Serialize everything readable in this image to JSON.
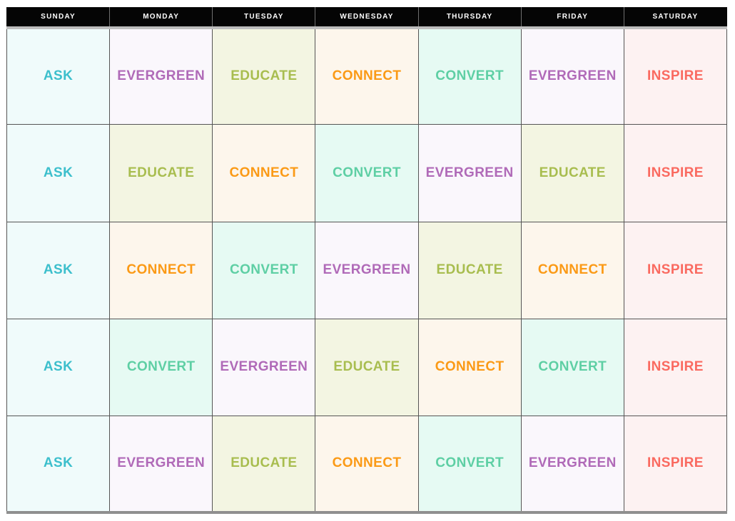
{
  "header": {
    "days": [
      "SUNDAY",
      "MONDAY",
      "TUESDAY",
      "WEDNESDAY",
      "THURSDAY",
      "FRIDAY",
      "SATURDAY"
    ]
  },
  "legend": {
    "categories": [
      {
        "key": "ASK",
        "label": "ASK",
        "text_color": "#3cbfcc",
        "cell_color": "#f0fbfb"
      },
      {
        "key": "EVERGREEN",
        "label": "EVERGREEN",
        "text_color": "#b06ab8",
        "cell_color": "#faf7fc"
      },
      {
        "key": "EDUCATE",
        "label": "EDUCATE",
        "text_color": "#a8bd4f",
        "cell_color": "#f3f5e2"
      },
      {
        "key": "CONNECT",
        "label": "CONNECT",
        "text_color": "#fb9a16",
        "cell_color": "#fdf6ec"
      },
      {
        "key": "CONVERT",
        "label": "CONVERT",
        "text_color": "#5ecfa4",
        "cell_color": "#e6faf3"
      },
      {
        "key": "INSPIRE",
        "label": "INSPIRE",
        "text_color": "#fa6a60",
        "cell_color": "#fdf2f2"
      }
    ]
  },
  "grid": {
    "rows": [
      {
        "row_index": 1,
        "cells": [
          {
            "day": "SUNDAY",
            "label": "ASK",
            "text_color": "#3cbfcc",
            "cell_color": "#f0fbfb"
          },
          {
            "day": "MONDAY",
            "label": "EVERGREEN",
            "text_color": "#b06ab8",
            "cell_color": "#faf7fc"
          },
          {
            "day": "TUESDAY",
            "label": "EDUCATE",
            "text_color": "#a8bd4f",
            "cell_color": "#f3f5e2"
          },
          {
            "day": "WEDNESDAY",
            "label": "CONNECT",
            "text_color": "#fb9a16",
            "cell_color": "#fdf6ec"
          },
          {
            "day": "THURSDAY",
            "label": "CONVERT",
            "text_color": "#5ecfa4",
            "cell_color": "#e6faf3"
          },
          {
            "day": "FRIDAY",
            "label": "EVERGREEN",
            "text_color": "#b06ab8",
            "cell_color": "#faf7fc"
          },
          {
            "day": "SATURDAY",
            "label": "INSPIRE",
            "text_color": "#fa6a60",
            "cell_color": "#fdf2f2"
          }
        ]
      },
      {
        "row_index": 2,
        "cells": [
          {
            "day": "SUNDAY",
            "label": "ASK",
            "text_color": "#3cbfcc",
            "cell_color": "#f0fbfb"
          },
          {
            "day": "MONDAY",
            "label": "EDUCATE",
            "text_color": "#a8bd4f",
            "cell_color": "#f3f5e2"
          },
          {
            "day": "TUESDAY",
            "label": "CONNECT",
            "text_color": "#fb9a16",
            "cell_color": "#fdf6ec"
          },
          {
            "day": "WEDNESDAY",
            "label": "CONVERT",
            "text_color": "#5ecfa4",
            "cell_color": "#e6faf3"
          },
          {
            "day": "THURSDAY",
            "label": "EVERGREEN",
            "text_color": "#b06ab8",
            "cell_color": "#faf7fc"
          },
          {
            "day": "FRIDAY",
            "label": "EDUCATE",
            "text_color": "#a8bd4f",
            "cell_color": "#f3f5e2"
          },
          {
            "day": "SATURDAY",
            "label": "INSPIRE",
            "text_color": "#fa6a60",
            "cell_color": "#fdf2f2"
          }
        ]
      },
      {
        "row_index": 3,
        "cells": [
          {
            "day": "SUNDAY",
            "label": "ASK",
            "text_color": "#3cbfcc",
            "cell_color": "#f0fbfb"
          },
          {
            "day": "MONDAY",
            "label": "CONNECT",
            "text_color": "#fb9a16",
            "cell_color": "#fdf6ec"
          },
          {
            "day": "TUESDAY",
            "label": "CONVERT",
            "text_color": "#5ecfa4",
            "cell_color": "#e6faf3"
          },
          {
            "day": "WEDNESDAY",
            "label": "EVERGREEN",
            "text_color": "#b06ab8",
            "cell_color": "#faf7fc"
          },
          {
            "day": "THURSDAY",
            "label": "EDUCATE",
            "text_color": "#a8bd4f",
            "cell_color": "#f3f5e2"
          },
          {
            "day": "FRIDAY",
            "label": "CONNECT",
            "text_color": "#fb9a16",
            "cell_color": "#fdf6ec"
          },
          {
            "day": "SATURDAY",
            "label": "INSPIRE",
            "text_color": "#fa6a60",
            "cell_color": "#fdf2f2"
          }
        ]
      },
      {
        "row_index": 4,
        "cells": [
          {
            "day": "SUNDAY",
            "label": "ASK",
            "text_color": "#3cbfcc",
            "cell_color": "#f0fbfb"
          },
          {
            "day": "MONDAY",
            "label": "CONVERT",
            "text_color": "#5ecfa4",
            "cell_color": "#e6faf3"
          },
          {
            "day": "TUESDAY",
            "label": "EVERGREEN",
            "text_color": "#b06ab8",
            "cell_color": "#faf7fc"
          },
          {
            "day": "WEDNESDAY",
            "label": "EDUCATE",
            "text_color": "#a8bd4f",
            "cell_color": "#f3f5e2"
          },
          {
            "day": "THURSDAY",
            "label": "CONNECT",
            "text_color": "#fb9a16",
            "cell_color": "#fdf6ec"
          },
          {
            "day": "FRIDAY",
            "label": "CONVERT",
            "text_color": "#5ecfa4",
            "cell_color": "#e6faf3"
          },
          {
            "day": "SATURDAY",
            "label": "INSPIRE",
            "text_color": "#fa6a60",
            "cell_color": "#fdf2f2"
          }
        ]
      },
      {
        "row_index": 5,
        "cells": [
          {
            "day": "SUNDAY",
            "label": "ASK",
            "text_color": "#3cbfcc",
            "cell_color": "#f0fbfb"
          },
          {
            "day": "MONDAY",
            "label": "EVERGREEN",
            "text_color": "#b06ab8",
            "cell_color": "#faf7fc"
          },
          {
            "day": "TUESDAY",
            "label": "EDUCATE",
            "text_color": "#a8bd4f",
            "cell_color": "#f3f5e2"
          },
          {
            "day": "WEDNESDAY",
            "label": "CONNECT",
            "text_color": "#fb9a16",
            "cell_color": "#fdf6ec"
          },
          {
            "day": "THURSDAY",
            "label": "CONVERT",
            "text_color": "#5ecfa4",
            "cell_color": "#e6faf3"
          },
          {
            "day": "FRIDAY",
            "label": "EVERGREEN",
            "text_color": "#b06ab8",
            "cell_color": "#faf7fc"
          },
          {
            "day": "SATURDAY",
            "label": "INSPIRE",
            "text_color": "#fa6a60",
            "cell_color": "#fdf2f2"
          }
        ]
      }
    ]
  },
  "style": {
    "header_bg": "#050505",
    "header_text": "#ffffff",
    "grid_line": "#555555",
    "page_bg": "#ffffff"
  }
}
